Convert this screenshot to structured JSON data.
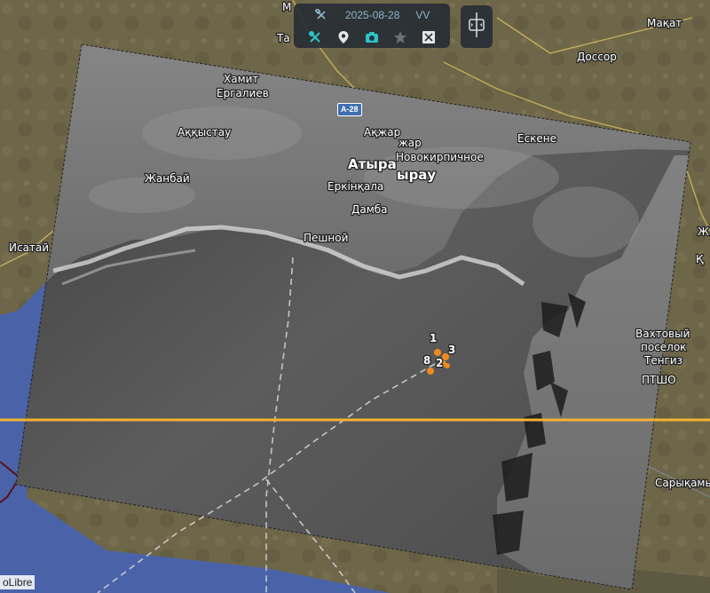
{
  "toolbar": {
    "date": "2025-08-28",
    "polarization": "VV",
    "icons": [
      "satellite-icon",
      "satellite-pin-icon",
      "camera-icon",
      "star-icon",
      "crop-icon"
    ],
    "accent": "#2ec4c4"
  },
  "compare_button": {
    "icon": "compare-slider-icon"
  },
  "road_shield": "A-28",
  "places": {
    "makat": "Мақат",
    "dossor": "Доссор",
    "hamit": "Хамит",
    "ergaliev": "Ергалиев",
    "akkystau": "Аққыстау",
    "zhanbai": "Жанбай",
    "isatai": "Исатай",
    "atyrau1": "Атыра",
    "atyrau2": "ырау",
    "akzhar": "Ақжар",
    "zhar": "жар",
    "novokirpichnoe": "Новокирпичное",
    "eskene": "Ескене",
    "erkinkala": "Еркінқала",
    "damba": "Дамба",
    "peshnoy": "Пешной",
    "vakhtovy1": "Вахтовый",
    "vakhtovy2": "поселок",
    "vakhtovy3": "Тенгиз",
    "ptsho": "ПТШО",
    "sarykamys": "Сарықамы",
    "m_top": "М",
    "ta": "Та",
    "zh": "Ж",
    "kaz": "Қ"
  },
  "markers": [
    {
      "label": "1",
      "color": "#f08a1c"
    },
    {
      "label": "3",
      "color": "#f08a1c"
    },
    {
      "label": "8",
      "color": "#f08a1c"
    },
    {
      "label": "2",
      "color": "#f08a1c"
    }
  ],
  "colors": {
    "sea": "#4a63a8",
    "divider_line": "#f2b233",
    "route_line": "#d8d8d8"
  },
  "attribution": "oLibre"
}
